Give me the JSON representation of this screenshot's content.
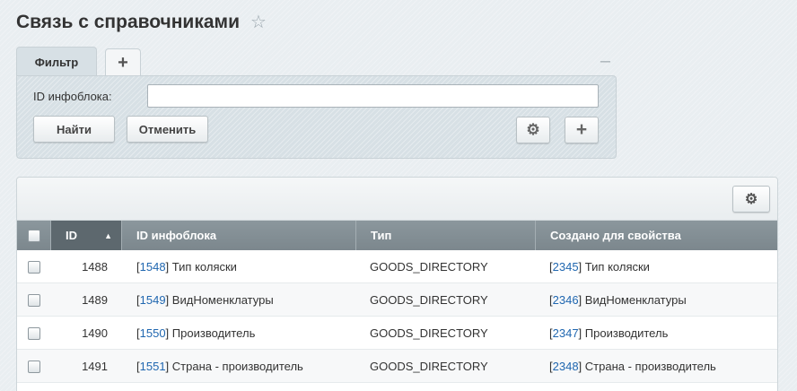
{
  "page": {
    "title": "Связь с справочниками",
    "star_icon": "☆"
  },
  "filter": {
    "tab_label": "Фильтр",
    "add_tab_icon": "+",
    "collapse_icon": "–",
    "field_label": "ID инфоблока:",
    "field_value": "",
    "find_button": "Найти",
    "cancel_button": "Отменить",
    "gear_icon": "⚙",
    "plus_icon": "+"
  },
  "grid": {
    "settings_icon": "⚙",
    "columns": {
      "id": "ID",
      "sort_arrow": "▲",
      "iblock": "ID инфоблока",
      "type": "Тип",
      "created_for": "Создано для свойства"
    },
    "rows": [
      {
        "id": "1488",
        "iblock_id": "1548",
        "iblock_name": "Тип коляски",
        "type": "GOODS_DIRECTORY",
        "prop_id": "2345",
        "prop_name": "Тип коляски"
      },
      {
        "id": "1489",
        "iblock_id": "1549",
        "iblock_name": "ВидНоменклатуры",
        "type": "GOODS_DIRECTORY",
        "prop_id": "2346",
        "prop_name": "ВидНоменклатуры"
      },
      {
        "id": "1490",
        "iblock_id": "1550",
        "iblock_name": "Производитель",
        "type": "GOODS_DIRECTORY",
        "prop_id": "2347",
        "prop_name": "Производитель"
      },
      {
        "id": "1491",
        "iblock_id": "1551",
        "iblock_name": "Страна - производитель",
        "type": "GOODS_DIRECTORY",
        "prop_id": "2348",
        "prop_name": "Страна - производитель"
      }
    ]
  }
}
